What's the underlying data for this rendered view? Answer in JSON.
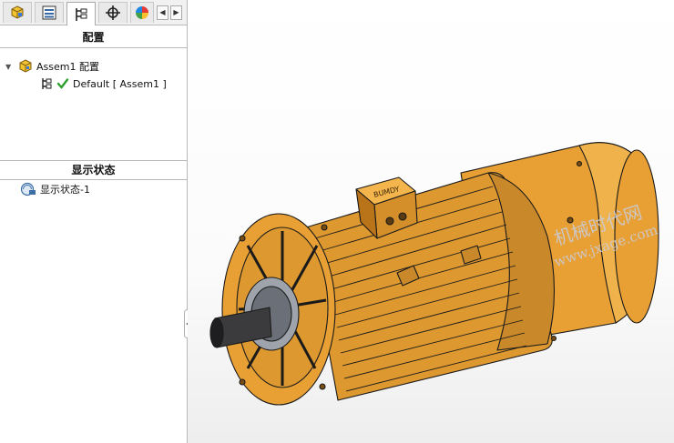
{
  "tabs": [
    {
      "name": "feature-manager",
      "icon": "assembly-cube-icon"
    },
    {
      "name": "property-manager",
      "icon": "property-list-icon"
    },
    {
      "name": "configuration-manager",
      "icon": "configuration-icon",
      "active": true
    },
    {
      "name": "dimxpert-manager",
      "icon": "crosshair-target-icon"
    },
    {
      "name": "display-manager",
      "icon": "color-wheel-icon"
    }
  ],
  "configuration": {
    "header": "配置",
    "root_label": "Assem1 配置",
    "default_label": "Default [ Assem1 ]"
  },
  "display_states": {
    "header": "显示状态",
    "item_label": "显示状态-1"
  },
  "watermark": {
    "line1": "机械时代网",
    "line2": "www.jxage.com"
  },
  "model": {
    "nameplate": "BUMDY",
    "body_color": "#e8a035",
    "shadow_color": "#b9741a",
    "edge_color": "#1a1a1a"
  }
}
